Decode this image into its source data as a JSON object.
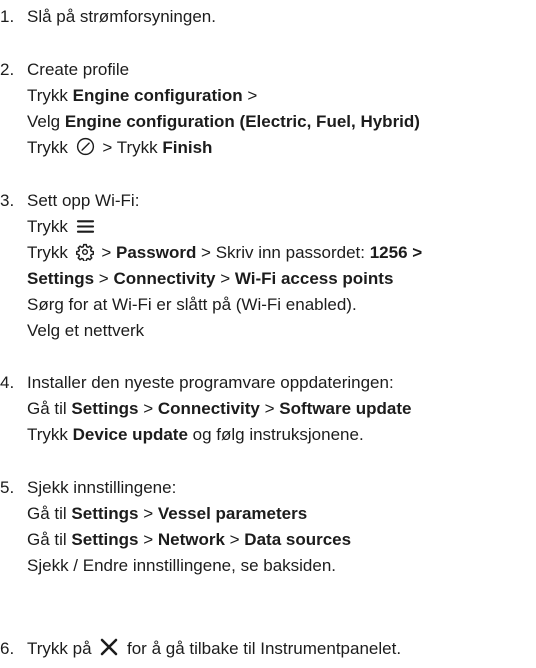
{
  "steps": [
    {
      "number": "1.",
      "lines": [
        [
          {
            "t": "Slå på strømforsyningen."
          }
        ]
      ]
    },
    {
      "number": "2.",
      "lines": [
        [
          {
            "t": "Create profile"
          }
        ],
        [
          {
            "t": "Trykk "
          },
          {
            "t": "Engine configuration",
            "b": true
          },
          {
            "t": " >"
          }
        ],
        [
          {
            "t": "Velg "
          },
          {
            "t": "Engine configuration (Electric, Fuel, Hybrid)",
            "b": true
          }
        ],
        [
          {
            "t": "Trykk "
          },
          {
            "icon": "checkmark-circle-icon"
          },
          {
            "t": " > Trykk "
          },
          {
            "t": "Finish",
            "b": true
          }
        ]
      ]
    },
    {
      "number": "3.",
      "lines": [
        [
          {
            "t": "Sett opp Wi-Fi:"
          }
        ],
        [
          {
            "t": "Trykk "
          },
          {
            "icon": "menu-icon"
          }
        ],
        [
          {
            "t": "Trykk "
          },
          {
            "icon": "gear-icon"
          },
          {
            "t": " > "
          },
          {
            "t": "Password",
            "b": true
          },
          {
            "t": " > Skriv inn passordet: "
          },
          {
            "t": "1256 >",
            "b": true
          }
        ],
        [
          {
            "t": "Settings",
            "b": true
          },
          {
            "t": " > "
          },
          {
            "t": "Connectivity",
            "b": true
          },
          {
            "t": " > "
          },
          {
            "t": "Wi-Fi access points",
            "b": true
          }
        ],
        [
          {
            "t": "Sørg for at Wi-Fi er slått på (Wi-Fi enabled)."
          }
        ],
        [
          {
            "t": "Velg et nettverk"
          }
        ]
      ]
    },
    {
      "number": "4.",
      "lines": [
        [
          {
            "t": "Installer den nyeste programvare oppdateringen:"
          }
        ],
        [
          {
            "t": "Gå til "
          },
          {
            "t": "Settings",
            "b": true
          },
          {
            "t": " > "
          },
          {
            "t": "Connectivity",
            "b": true
          },
          {
            "t": " > "
          },
          {
            "t": "Software update",
            "b": true
          }
        ],
        [
          {
            "t": "Trykk "
          },
          {
            "t": "Device update",
            "b": true
          },
          {
            "t": " og følg instruksjonene."
          }
        ]
      ]
    },
    {
      "number": "5.",
      "lines": [
        [
          {
            "t": "Sjekk innstillingene:"
          }
        ],
        [
          {
            "t": "Gå til "
          },
          {
            "t": "Settings",
            "b": true
          },
          {
            "t": " > "
          },
          {
            "t": "Vessel parameters",
            "b": true
          }
        ],
        [
          {
            "t": "Gå til "
          },
          {
            "t": "Settings",
            "b": true
          },
          {
            "t": " > "
          },
          {
            "t": "Network",
            "b": true
          },
          {
            "t": " > "
          },
          {
            "t": "Data sources",
            "b": true
          }
        ],
        [
          {
            "t": "Sjekk / Endre innstillingene, se baksiden."
          }
        ]
      ]
    },
    {
      "number": "6.",
      "lines": [
        [
          {
            "t": "Trykk på "
          },
          {
            "icon": "close-icon"
          },
          {
            "t": " for å gå tilbake til Instrumentpanelet."
          }
        ]
      ]
    }
  ]
}
